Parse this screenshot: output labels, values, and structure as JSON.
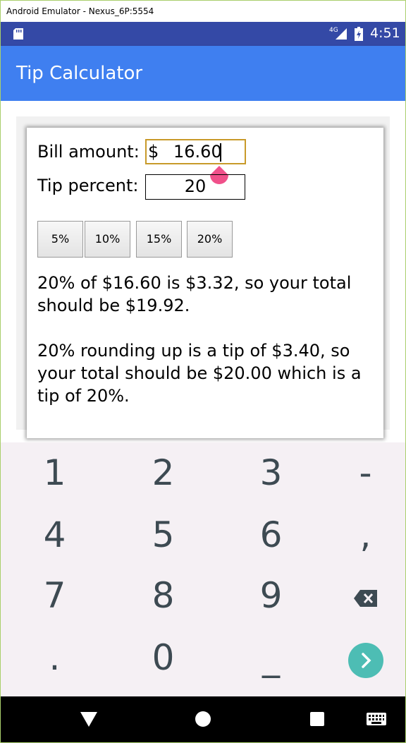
{
  "window": {
    "title": "Android Emulator - Nexus_6P:5554"
  },
  "statusbar": {
    "network": "4G",
    "time": "4:51"
  },
  "appbar": {
    "title": "Tip Calculator"
  },
  "form": {
    "bill_label": "Bill amount:",
    "bill_currency": "$",
    "bill_value": "16.60",
    "tip_label": "Tip percent:",
    "tip_value": "20"
  },
  "tip_buttons": [
    "5%",
    "10%",
    "15%",
    "20%"
  ],
  "results": {
    "line1": "20% of $16.60 is $3.32, so your total should be $19.92.",
    "line2": "20% rounding up is a tip of $3.40, so your total should be $20.00 which is a tip of 20%."
  },
  "keyboard": {
    "row1": [
      "1",
      "2",
      "3",
      "-"
    ],
    "row2": [
      "4",
      "5",
      "6",
      ","
    ],
    "row3": [
      "7",
      "8",
      "9"
    ],
    "row4": [
      ".",
      "0",
      "_"
    ],
    "icons": [
      "backspace-icon",
      "go-icon"
    ]
  },
  "navbar": {
    "icons": [
      "back-icon",
      "home-icon",
      "recents-icon",
      "keyboard-switch-icon"
    ]
  },
  "colors": {
    "statusbar": "#3449a6",
    "appbar": "#3f7ff0",
    "accent_handle": "#f0508a",
    "go_button": "#4dbdb4",
    "keyboard_bg": "#f5f0f4",
    "key_text": "#3d4a52",
    "field_focus_border": "#c89a2a"
  }
}
